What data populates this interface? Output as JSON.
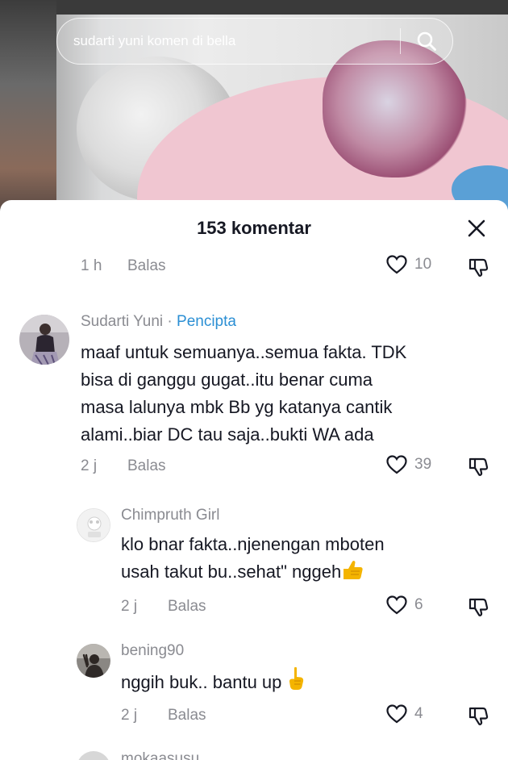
{
  "search": {
    "query": "sudarti yuni komen di bella",
    "icon": "search-icon"
  },
  "panel": {
    "title": "153 komentar",
    "close_icon": "close-icon"
  },
  "partial_top": {
    "time": "1 h",
    "reply_label": "Balas",
    "likes": "10"
  },
  "comments": [
    {
      "author": "Sudarti Yuni",
      "separator": "·",
      "badge": "Pencipta",
      "lines": [
        "maaf untuk semuanya..semua fakta. TDK",
        "bisa di ganggu gugat..itu benar cuma",
        "masa lalunya mbk Bb yg katanya cantik",
        "alami..biar DC tau saja..bukti WA ada"
      ],
      "time": "2 j",
      "reply_label": "Balas",
      "likes": "39"
    },
    {
      "author": "Chimpruth Girl",
      "lines": [
        "klo bnar fakta..njenengan mboten",
        "usah takut bu..sehat\" nggeh"
      ],
      "emoji": "thumbs-up",
      "time": "2 j",
      "reply_label": "Balas",
      "likes": "6"
    },
    {
      "author": "bening90",
      "lines": [
        "nggih buk.. bantu up"
      ],
      "emoji": "pointing-up",
      "time": "2 j",
      "reply_label": "Balas",
      "likes": "4"
    }
  ],
  "partial_bottom": {
    "author": "mokaasusu"
  },
  "colors": {
    "text": "#161823",
    "muted": "#8a8b91",
    "creator": "#2b8fd4",
    "emoji": "#f4b400"
  }
}
